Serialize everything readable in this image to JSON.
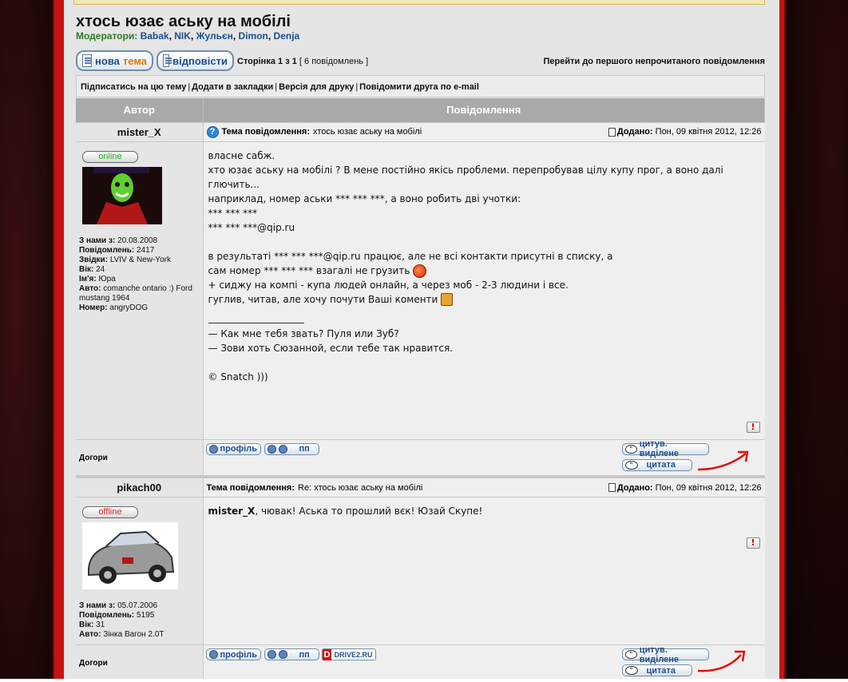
{
  "topic": {
    "title": "хтось юзає аську на мобілі",
    "moderators_label": "Модератори:",
    "moderators": [
      "Babak",
      "NIK",
      "Жульєн",
      "Dimon",
      "Denja"
    ]
  },
  "toolbar": {
    "new_topic_1": "нова",
    "new_topic_2": "тема",
    "reply": "відповісти",
    "page_prefix": "Сторінка",
    "page_current": "1",
    "page_of": "з",
    "page_total": "1",
    "post_count": "[ 6 повідомлень ]",
    "jump_unread": "Перейти до першого непрочитаного повідомлення"
  },
  "actions": {
    "subscribe": "Підписатись на цю тему",
    "bookmark": "Додати в закладки",
    "print": "Версія для друку",
    "email": "Повідомити друга по e-mail"
  },
  "table": {
    "col_author": "Автор",
    "col_message": "Повідомлення"
  },
  "posts": [
    {
      "author": "mister_X",
      "subject_label": "Тема повідомлення:",
      "subject": "хтось юзає аську на мобілі",
      "posted_label": "Додано:",
      "posted": "Пон, 09 квітня 2012, 12:26",
      "status": "online",
      "profile": {
        "joined_label": "З нами з:",
        "joined": "20.08.2008",
        "posts_label": "Повідомлень:",
        "posts": "2417",
        "from_label": "Звідки:",
        "from": "LVIV & New-York",
        "age_label": "Вік:",
        "age": "24",
        "name_label": "Ім'я:",
        "name": "Юра",
        "car_label": "Авто:",
        "car": "comanche ontario :) Ford mustang 1964",
        "nick_label": "Номер:",
        "nick": "angryDOG"
      },
      "body": {
        "l1": "власне сабж.",
        "l2": "хто юзає аську на мобілі ? В мене постійно якісь проблеми. перепробував цілу купу прог, а воно далі глючить...",
        "l3": "наприклад, номер аськи *** *** ***, а воно робить дві учотки:",
        "l4": "*** *** ***",
        "l5": "*** *** ***@qip.ru",
        "l6": "в результаті *** *** ***@qip.ru працює, але не всі контакти присутні в списку, а",
        "l7": "сам номер *** *** *** взагалі не грузить",
        "l8": "+ сиджу на компі - купа людей онлайн, а через моб - 2-3 людини і все.",
        "l9": "гуглив, читав, але хочу почути Ваші коменти",
        "sig1": "— Как мне тебя звать? Пуля или Зуб?",
        "sig2": "— Зови хоть Сюзанной, если тебе так нравится.",
        "sig3": "© Snatch )))"
      },
      "footer": {
        "top": "Догори",
        "profile": "профіль",
        "pm": "пп",
        "quote_sel": "цитув. виділене",
        "quote": "цитата"
      }
    },
    {
      "author": "pikach00",
      "subject_label": "Тема повідомлення:",
      "subject": "Re: хтось юзає аську на мобілі",
      "posted_label": "Додано:",
      "posted": "Пон, 09 квітня 2012, 12:26",
      "status": "offline",
      "profile": {
        "joined_label": "З нами з:",
        "joined": "05.07.2006",
        "posts_label": "Повідомлень:",
        "posts": "5195",
        "age_label": "Вік:",
        "age": "31",
        "car_label": "Авто:",
        "car": "Зінка Вагон 2.0T"
      },
      "body": {
        "mention": "mister_X",
        "text": ", чювак! Аська то прошлий вєк! Юзай Скупе!"
      },
      "footer": {
        "top": "Догори",
        "profile": "профіль",
        "pm": "пп",
        "drive": "DRIVE2.RU",
        "quote_sel": "цитув. виділене",
        "quote": "цитата"
      }
    }
  ]
}
